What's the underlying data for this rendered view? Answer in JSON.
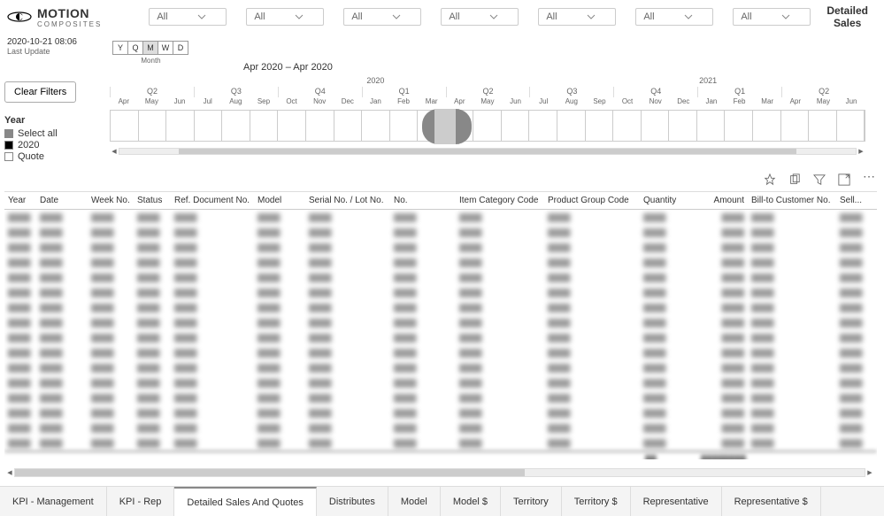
{
  "logo": {
    "main": "MOTION",
    "sub": "COMPOSITES"
  },
  "title": {
    "l1": "Detailed",
    "l2": "Sales"
  },
  "filters": [
    "All",
    "All",
    "All",
    "All",
    "All",
    "All",
    "All"
  ],
  "timestamp": "2020-10-21 08:06",
  "timestamp_label": "Last Update",
  "time_grain": {
    "options": [
      "Y",
      "Q",
      "M",
      "W",
      "D"
    ],
    "active": "M",
    "label": "Month"
  },
  "range_label": "Apr 2020 – Apr 2020",
  "clear_btn": "Clear Filters",
  "year_filter": {
    "title": "Year",
    "select_all": "Select all",
    "items": [
      "2020"
    ],
    "quote": "Quote"
  },
  "timeline": {
    "years": [
      {
        "label": "2020",
        "pos": 34
      },
      {
        "label": "2021",
        "pos": 78
      }
    ],
    "quarters": [
      "Q2",
      "Q3",
      "Q4",
      "Q1",
      "Q2",
      "Q3",
      "Q4",
      "Q1",
      "Q2"
    ],
    "months": [
      "Apr",
      "May",
      "Jun",
      "Jul",
      "Aug",
      "Sep",
      "Oct",
      "Nov",
      "Dec",
      "Jan",
      "Feb",
      "Mar",
      "Apr",
      "May",
      "Jun",
      "Jul",
      "Aug",
      "Sep",
      "Oct",
      "Nov",
      "Dec",
      "Jan",
      "Feb",
      "Mar",
      "Apr",
      "May",
      "Jun"
    ]
  },
  "columns": [
    "Year",
    "Date",
    "Week No.",
    "Status",
    "Ref. Document No.",
    "Model",
    "Serial No. / Lot No.",
    "No.",
    "Item Category Code",
    "Product Group Code",
    "Quantity",
    "Amount",
    "Bill-to Customer No.",
    "Sell..."
  ],
  "tabs": [
    "KPI - Management",
    "KPI - Rep",
    "Detailed Sales And Quotes",
    "Distributes",
    "Model",
    "Model $",
    "Territory",
    "Territory $",
    "Representative",
    "Representative $"
  ],
  "active_tab": 2
}
